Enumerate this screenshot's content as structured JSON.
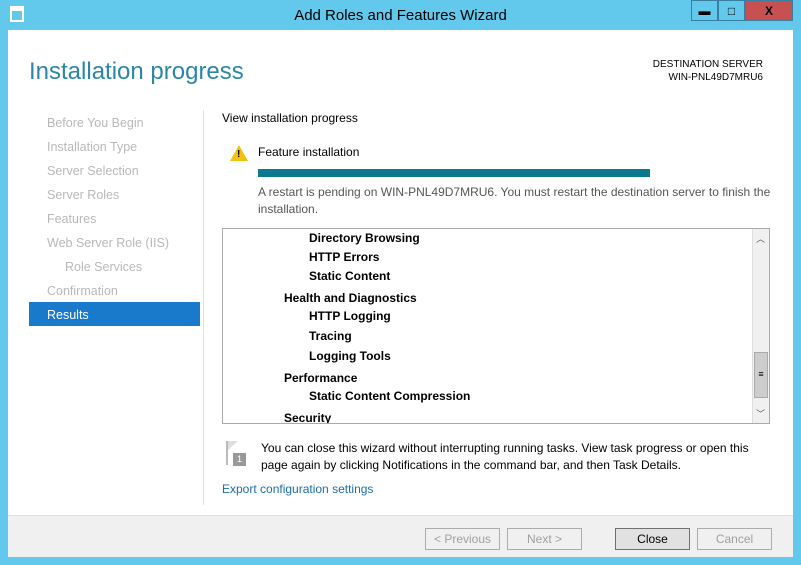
{
  "window": {
    "title": "Add Roles and Features Wizard",
    "minimize": "▬",
    "maximize": "□",
    "close": "X"
  },
  "header": {
    "title": "Installation progress",
    "dest_label": "DESTINATION SERVER",
    "dest_server": "WIN-PNL49D7MRU6"
  },
  "nav": [
    {
      "label": "Before You Begin"
    },
    {
      "label": "Installation Type"
    },
    {
      "label": "Server Selection"
    },
    {
      "label": "Server Roles"
    },
    {
      "label": "Features"
    },
    {
      "label": "Web Server Role (IIS)"
    },
    {
      "label": "Role Services"
    },
    {
      "label": "Confirmation"
    },
    {
      "label": "Results",
      "selected": true
    }
  ],
  "main": {
    "section": "View installation progress",
    "feature_label": "Feature installation",
    "progress_percent": 100,
    "progress_color": "#0b7a8f",
    "warning": "A restart is pending on WIN-PNL49D7MRU6. You must restart the destination server to finish the installation.",
    "items": [
      {
        "text": "Directory Browsing",
        "level": 2
      },
      {
        "text": "HTTP Errors",
        "level": 2
      },
      {
        "text": "Static Content",
        "level": 2
      },
      {
        "text": "Health and Diagnostics",
        "level": 1
      },
      {
        "text": "HTTP Logging",
        "level": 2
      },
      {
        "text": "Tracing",
        "level": 2
      },
      {
        "text": "Logging Tools",
        "level": 2
      },
      {
        "text": "Performance",
        "level": 1
      },
      {
        "text": "Static Content Compression",
        "level": 2
      },
      {
        "text": "Security",
        "level": 1
      }
    ],
    "note": "You can close this wizard without interrupting running tasks. View task progress or open this page again by clicking Notifications in the command bar, and then Task Details.",
    "note_badge": "1",
    "export_link": "Export configuration settings"
  },
  "footer": {
    "previous": "< Previous",
    "next": "Next >",
    "close": "Close",
    "cancel": "Cancel"
  }
}
